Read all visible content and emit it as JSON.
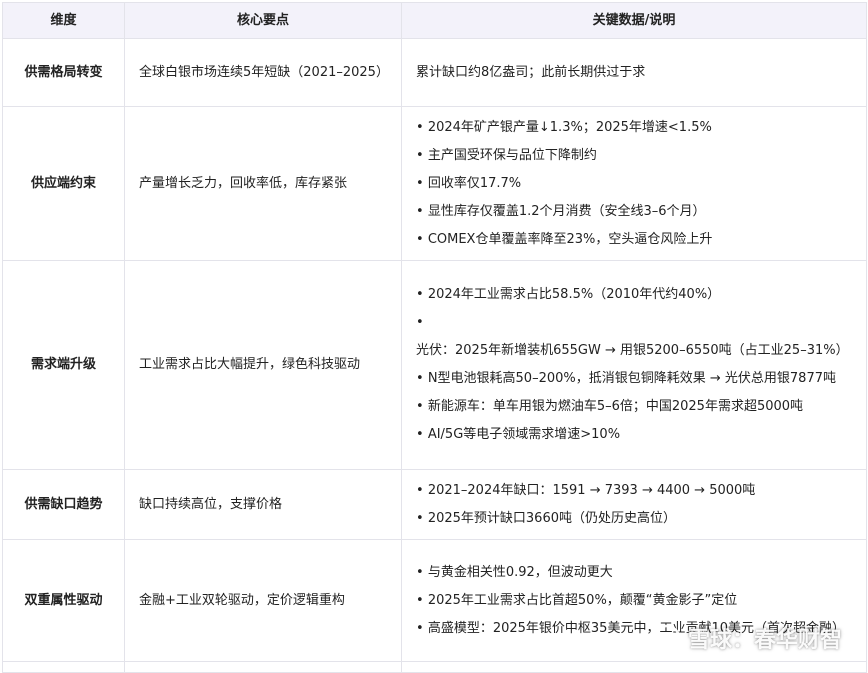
{
  "header": {
    "col1": "维度",
    "col2": "核心要点",
    "col3": "关键数据/说明"
  },
  "rows": [
    {
      "dimension": "供需格局转变",
      "core": "全球白银市场连续5年短缺（2021–2025）",
      "details": [
        "累计缺口约8亿盎司；此前长期供过于求"
      ]
    },
    {
      "dimension": "供应端约束",
      "core": "产量增长乏力，回收率低，库存紧张",
      "details": [
        "2024年矿产银产量↓1.3%；2025年增速<1.5%",
        "主产国受环保与品位下降制约",
        "回收率仅17.7%",
        "显性库存仅覆盖1.2个月消费（安全线3–6个月）",
        "COMEX仓单覆盖率降至23%，空头逼仓风险上升"
      ]
    },
    {
      "dimension": "需求端升级",
      "core": "工业需求占比大幅提升，绿色科技驱动",
      "details": [
        "2024年工业需求占比58.5%（2010年代约40%）",
        "光伏：2025年新增装机655GW → 用银5200–6550吨（占工业25–31%）",
        "N型电池银耗高50–200%，抵消银包铜降耗效果 → 光伏总用银7877吨",
        "新能源车：单车用银为燃油车5–6倍；中国2025年需求超5000吨",
        "AI/5G等电子领域需求增速>10%"
      ]
    },
    {
      "dimension": "供需缺口趋势",
      "core": "缺口持续高位，支撑价格",
      "details": [
        "2021–2024年缺口：1591 → 7393 → 4400 → 5000吨",
        "2025年预计缺口3660吨（仍处历史高位）"
      ]
    },
    {
      "dimension": "双重属性驱动",
      "core": "金融+工业双轮驱动，定价逻辑重构",
      "details": [
        "与黄金相关性0.92，但波动更大",
        "2025年工业需求占比首超50%，颠覆“黄金影子”定位",
        "高盛模型：2025年银价中枢35美元中，工业贡献10美元（首次超金融）"
      ]
    }
  ],
  "watermark": {
    "text": "雪球：春华财智",
    "icon": "snowball-logo-icon"
  }
}
